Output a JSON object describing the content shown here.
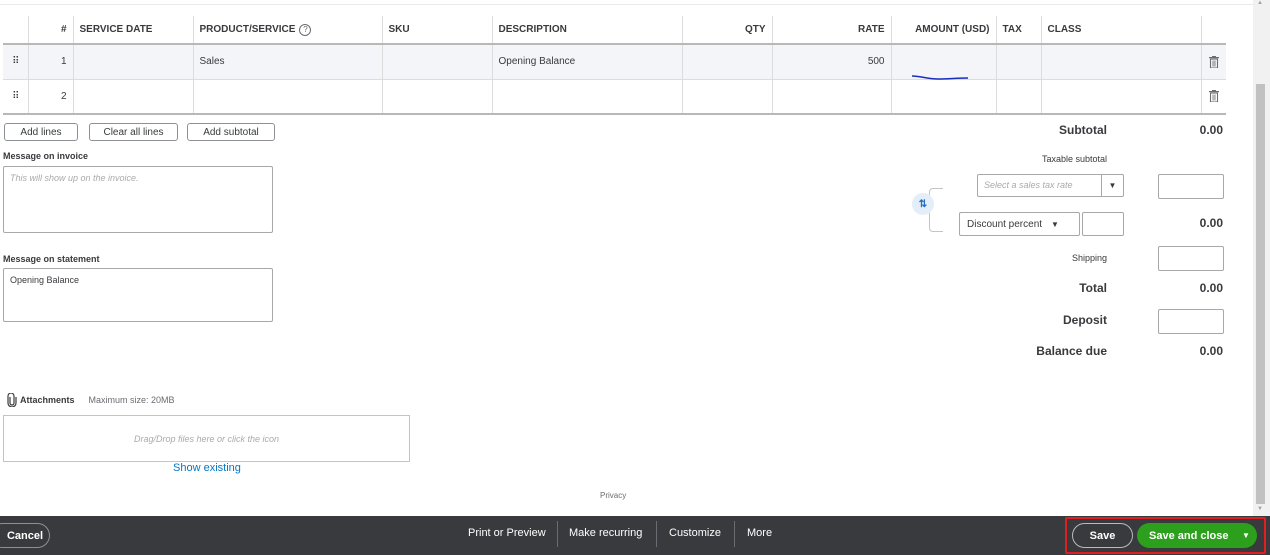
{
  "table": {
    "headers": [
      "",
      "#",
      "SERVICE DATE",
      "PRODUCT/SERVICE",
      "SKU",
      "DESCRIPTION",
      "QTY",
      "RATE",
      "AMOUNT (USD)",
      "TAX",
      "CLASS",
      ""
    ],
    "product_help_glyph": "?",
    "rows": [
      {
        "num": "1",
        "service_date": "",
        "product": "Sales",
        "sku": "",
        "description": "Opening Balance",
        "qty": "",
        "rate": "500",
        "amount": "",
        "tax": "",
        "class": ""
      },
      {
        "num": "2",
        "service_date": "",
        "product": "",
        "sku": "",
        "description": "",
        "qty": "",
        "rate": "",
        "amount": "",
        "tax": "",
        "class": ""
      }
    ]
  },
  "line_buttons": {
    "add_lines": "Add lines",
    "clear_all_lines": "Clear all lines",
    "add_subtotal": "Add subtotal"
  },
  "message_invoice": {
    "label": "Message on invoice",
    "placeholder": "This will show up on the invoice."
  },
  "message_statement": {
    "label": "Message on statement",
    "value": "Opening Balance"
  },
  "attachments": {
    "label": "Attachments",
    "max_size": "Maximum size: 20MB",
    "dropzone": "Drag/Drop files here or click the icon",
    "show_existing": "Show existing"
  },
  "privacy": "Privacy",
  "totals": {
    "subtotal_label": "Subtotal",
    "subtotal_value": "0.00",
    "taxable_subtotal_label": "Taxable subtotal",
    "tax_rate_placeholder": "Select a sales tax rate",
    "discount_type": "Discount percent",
    "discount_value": "0.00",
    "shipping_label": "Shipping",
    "total_label": "Total",
    "total_value": "0.00",
    "deposit_label": "Deposit",
    "balance_due_label": "Balance due",
    "balance_due_value": "0.00"
  },
  "footer": {
    "cancel": "Cancel",
    "print_preview": "Print or Preview",
    "make_recurring": "Make recurring",
    "customize": "Customize",
    "more": "More",
    "save": "Save",
    "save_and_close": "Save and close"
  },
  "colors": {
    "primary_green": "#2ca01c",
    "footer_bg": "#393a3d",
    "link_blue": "#0077c5",
    "highlight_red": "#e02020"
  }
}
